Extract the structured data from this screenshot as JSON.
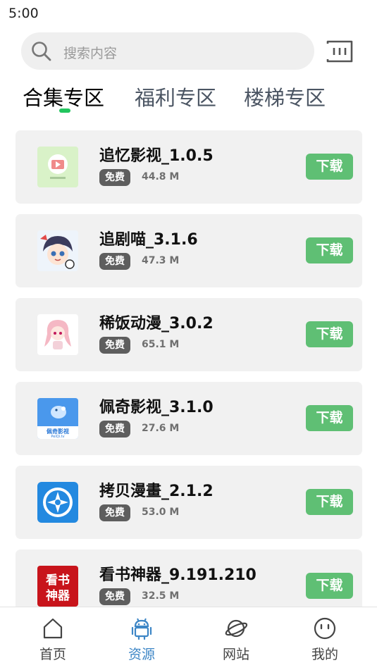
{
  "status_bar": {
    "time": "5:00"
  },
  "search": {
    "placeholder": "搜索内容",
    "icon": "search-icon",
    "scan_icon": "scan-icon"
  },
  "tabs": [
    {
      "label": "合集专区",
      "active": true
    },
    {
      "label": "福利专区",
      "active": false
    },
    {
      "label": "楼梯专区",
      "active": false
    }
  ],
  "apps": [
    {
      "name": "追忆影视_1.0.5",
      "badge": "免费",
      "size": "44.8 M",
      "button": "下载",
      "icon": "video-play-icon"
    },
    {
      "name": "追剧喵_3.1.6",
      "badge": "免费",
      "size": "47.3 M",
      "button": "下载",
      "icon": "anime-avatar-icon"
    },
    {
      "name": "稀饭动漫_3.0.2",
      "badge": "免费",
      "size": "65.1 M",
      "button": "下载",
      "icon": "anime-girl-icon"
    },
    {
      "name": "佩奇影视_3.1.0",
      "badge": "免费",
      "size": "27.6 M",
      "button": "下载",
      "icon": "peppa-tv-icon",
      "icon_text": "佩奇影视",
      "icon_subtext": "PeiQi.tv"
    },
    {
      "name": "拷贝漫畫_2.1.2",
      "badge": "免费",
      "size": "53.0 M",
      "button": "下载",
      "icon": "shutter-icon"
    },
    {
      "name": "看书神器_9.191.210",
      "badge": "免费",
      "size": "32.5 M",
      "button": "下载",
      "icon": "book-app-icon",
      "icon_text": "看书神器"
    }
  ],
  "bottom_nav": [
    {
      "label": "首页",
      "icon": "home-icon",
      "active": false
    },
    {
      "label": "资源",
      "icon": "android-icon",
      "active": true
    },
    {
      "label": "网站",
      "icon": "planet-icon",
      "active": false
    },
    {
      "label": "我的",
      "icon": "smiley-icon",
      "active": false
    }
  ],
  "colors": {
    "accent_green": "#5fbf74",
    "tab_indicator": "#22c55e",
    "nav_active": "#3d86c6",
    "badge": "#5e5e5e"
  }
}
